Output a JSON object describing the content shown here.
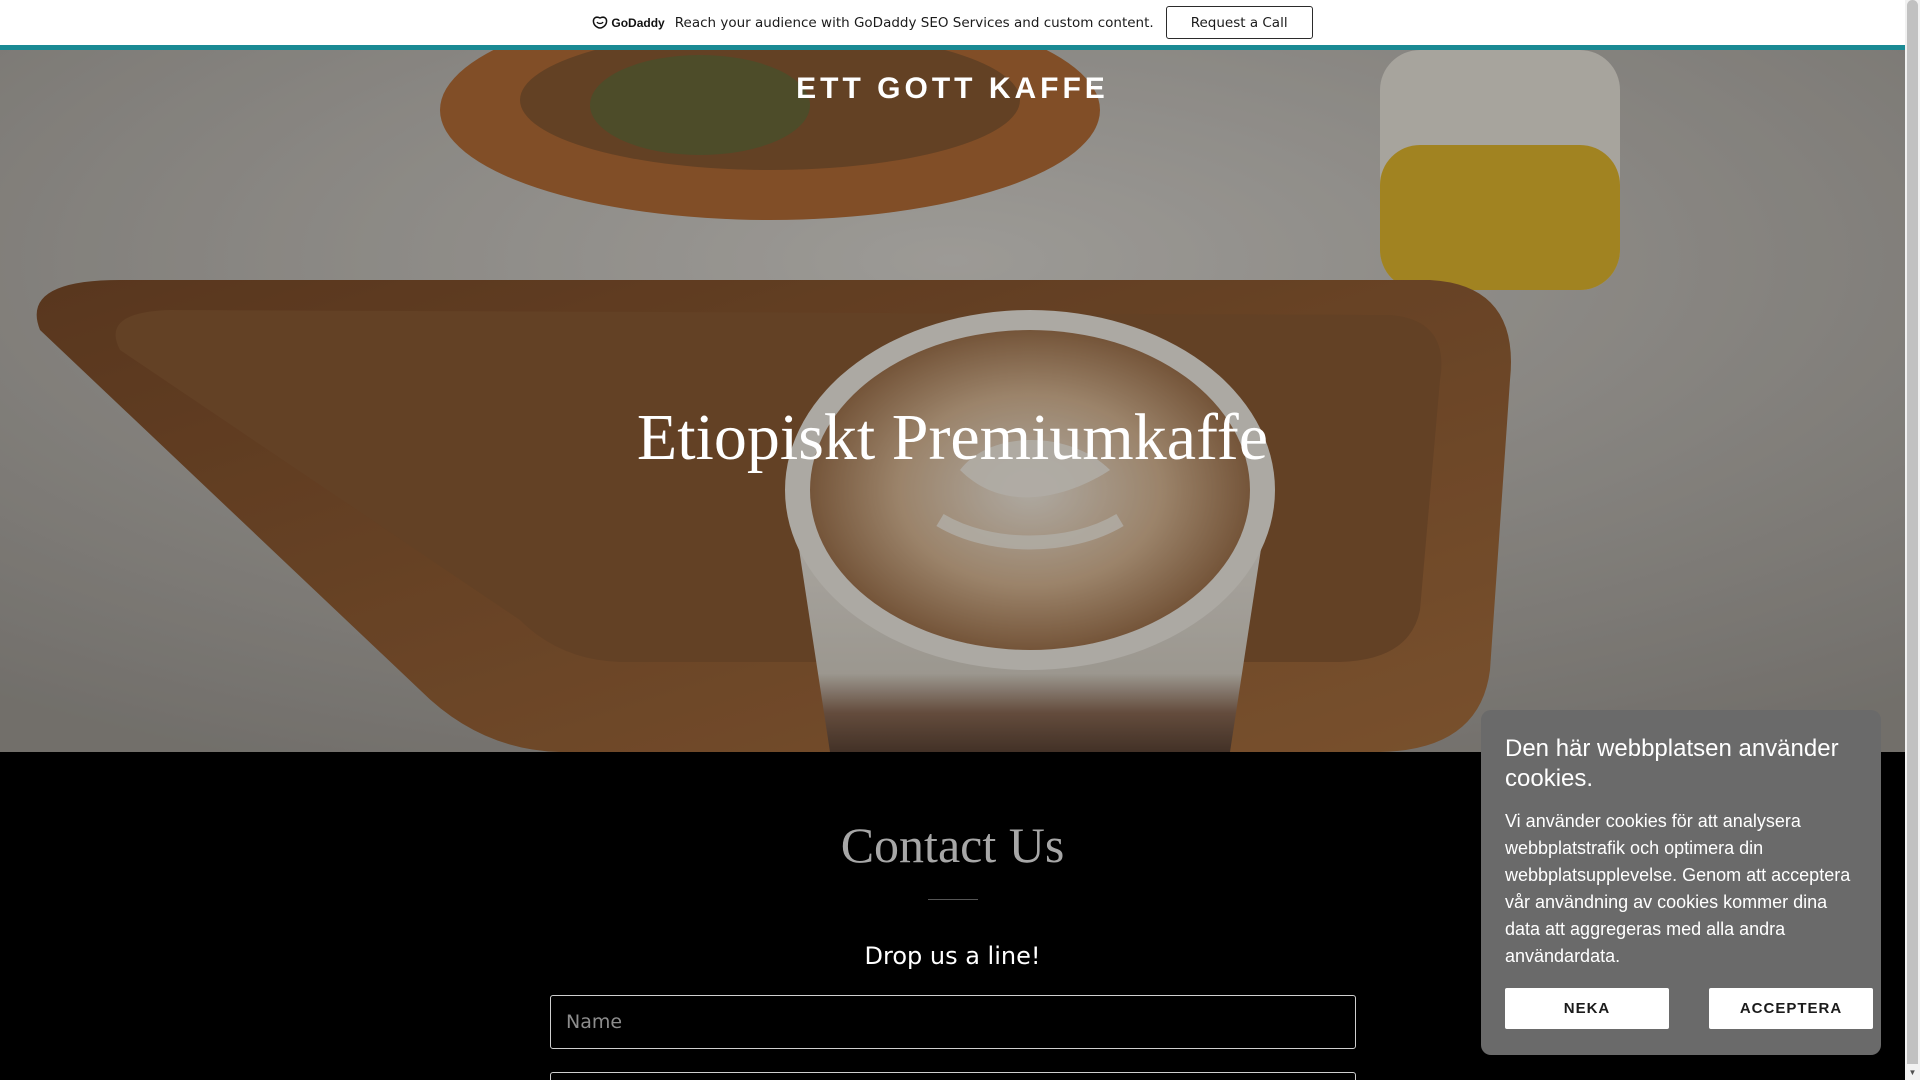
{
  "promo": {
    "logo_text": "GoDaddy",
    "message": "Reach your audience with GoDaddy SEO Services and custom content.",
    "button_label": "Request a Call"
  },
  "hero": {
    "site_title": "ETT GOTT KAFFE",
    "heading": "Etiopiskt Premiumkaffe"
  },
  "contact": {
    "title": "Contact Us",
    "subtitle": "Drop us a line!",
    "name_placeholder": "Name"
  },
  "cookie": {
    "title": "Den här webbplatsen använder cookies.",
    "body": "Vi använder cookies för att analysera webbplatstrafik och optimera din webbplatsupplevelse. Genom att acceptera vår användning av cookies kommer dina data att aggregeras med alla andra användardata.",
    "decline_label": "NEKA",
    "accept_label": "ACCEPTERA"
  },
  "colors": {
    "accent_teal": "#1a8a94",
    "cookie_bg": "#6a6a6a",
    "contact_bg": "#000000"
  },
  "icons": [
    "godaddy-logo-icon",
    "scroll-down-arrow-icon"
  ]
}
